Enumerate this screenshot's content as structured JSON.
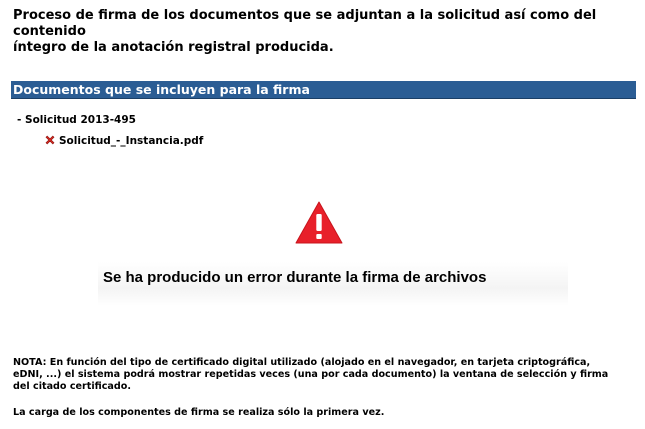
{
  "intro": {
    "line1": "Proceso de firma de los documentos que se adjuntan a la solicitud así como del contenido",
    "line2": "íntegro de la anotación registral producida."
  },
  "section": {
    "title": "Documentos que se incluyen para la firma"
  },
  "tree": {
    "root_label": "- Solicitud 2013-495",
    "files": [
      {
        "name": "Solicitud_-_Instancia.pdf",
        "icon": "red-x-icon"
      }
    ]
  },
  "error": {
    "icon": "warning-triangle-icon",
    "message": "Se ha producido un error durante la firma de archivos"
  },
  "notes": {
    "nota_line1": "NOTA: En función del tipo de certificado digital utilizado (alojado en el navegador, en tarjeta criptográfica,",
    "nota_line2": "eDNI, ...) el sistema podrá mostrar repetidas veces (una por cada documento) la ventana de selección y firma",
    "nota_line3": "del citado certificado.",
    "carga": "La carga de los componentes de firma se realiza sólo la primera vez."
  },
  "colors": {
    "section_bar": "#2b5d94",
    "warning_red": "#e8202a"
  }
}
